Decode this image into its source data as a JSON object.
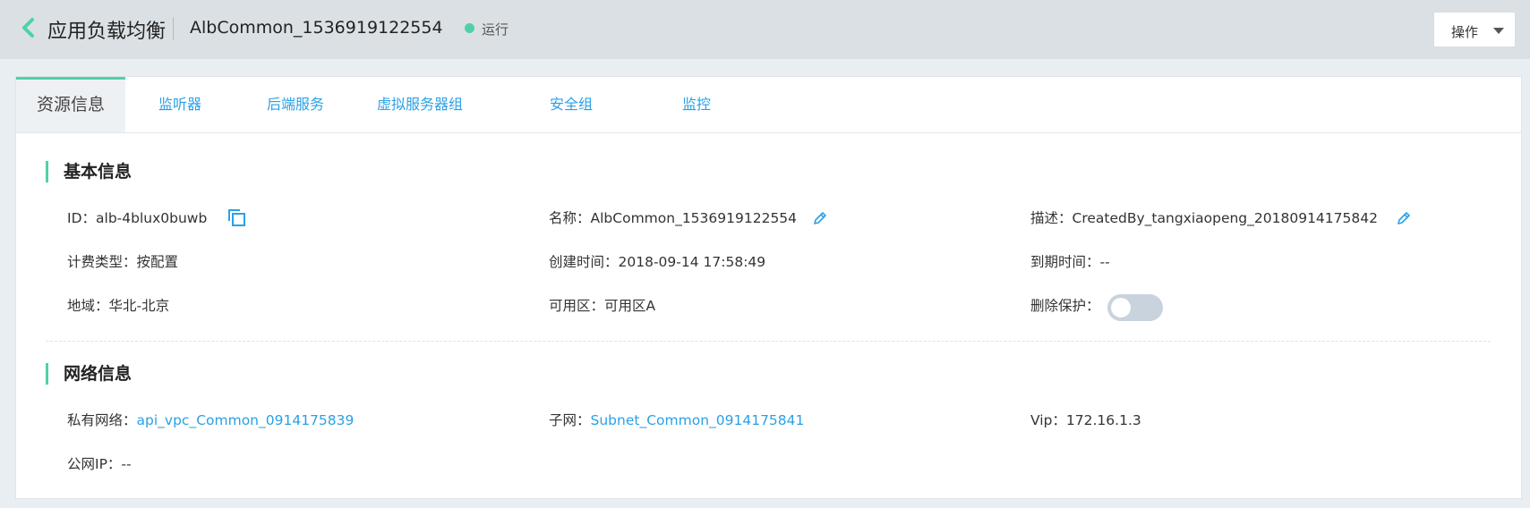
{
  "header": {
    "back_icon": "chevron-left-icon",
    "title": "应用负载均衡",
    "instance_name": "AlbCommon_1536919122554",
    "status": {
      "text": "运行",
      "color": "#4fd1a8"
    },
    "action_button": "操作"
  },
  "tabs": [
    {
      "label": "资源信息",
      "active": true
    },
    {
      "label": "监听器",
      "active": false
    },
    {
      "label": "后端服务",
      "active": false
    },
    {
      "label": "虚拟服务器组",
      "active": false
    },
    {
      "label": "安全组",
      "active": false
    },
    {
      "label": "监控",
      "active": false
    }
  ],
  "basic": {
    "title": "基本信息",
    "id": {
      "label": "ID：",
      "value": "alb-4blux0buwb"
    },
    "name": {
      "label": "名称：",
      "value": "AlbCommon_1536919122554"
    },
    "description": {
      "label": "描述：",
      "value": "CreatedBy_tangxiaopeng_20180914175842"
    },
    "billing": {
      "label": "计费类型：",
      "value": "按配置"
    },
    "created": {
      "label": "创建时间：",
      "value": "2018-09-14 17:58:49"
    },
    "expire": {
      "label": "到期时间：",
      "value": "--"
    },
    "region": {
      "label": "地域：",
      "value": "华北-北京"
    },
    "az": {
      "label": "可用区：",
      "value": "可用区A"
    },
    "delete_protection": {
      "label": "删除保护：",
      "enabled": false
    }
  },
  "network": {
    "title": "网络信息",
    "vpc": {
      "label": "私有网络：",
      "value": "api_vpc_Common_0914175839"
    },
    "subnet": {
      "label": "子网：",
      "value": "Subnet_Common_0914175841"
    },
    "vip": {
      "label": "Vip：",
      "value": "172.16.1.3"
    },
    "public_ip": {
      "label": "公网IP：",
      "value": "--"
    }
  },
  "colors": {
    "accent": "#4fd1a8",
    "link": "#2aa1e6",
    "header_bg": "#dbe0e4",
    "page_bg": "#e9eef2"
  }
}
